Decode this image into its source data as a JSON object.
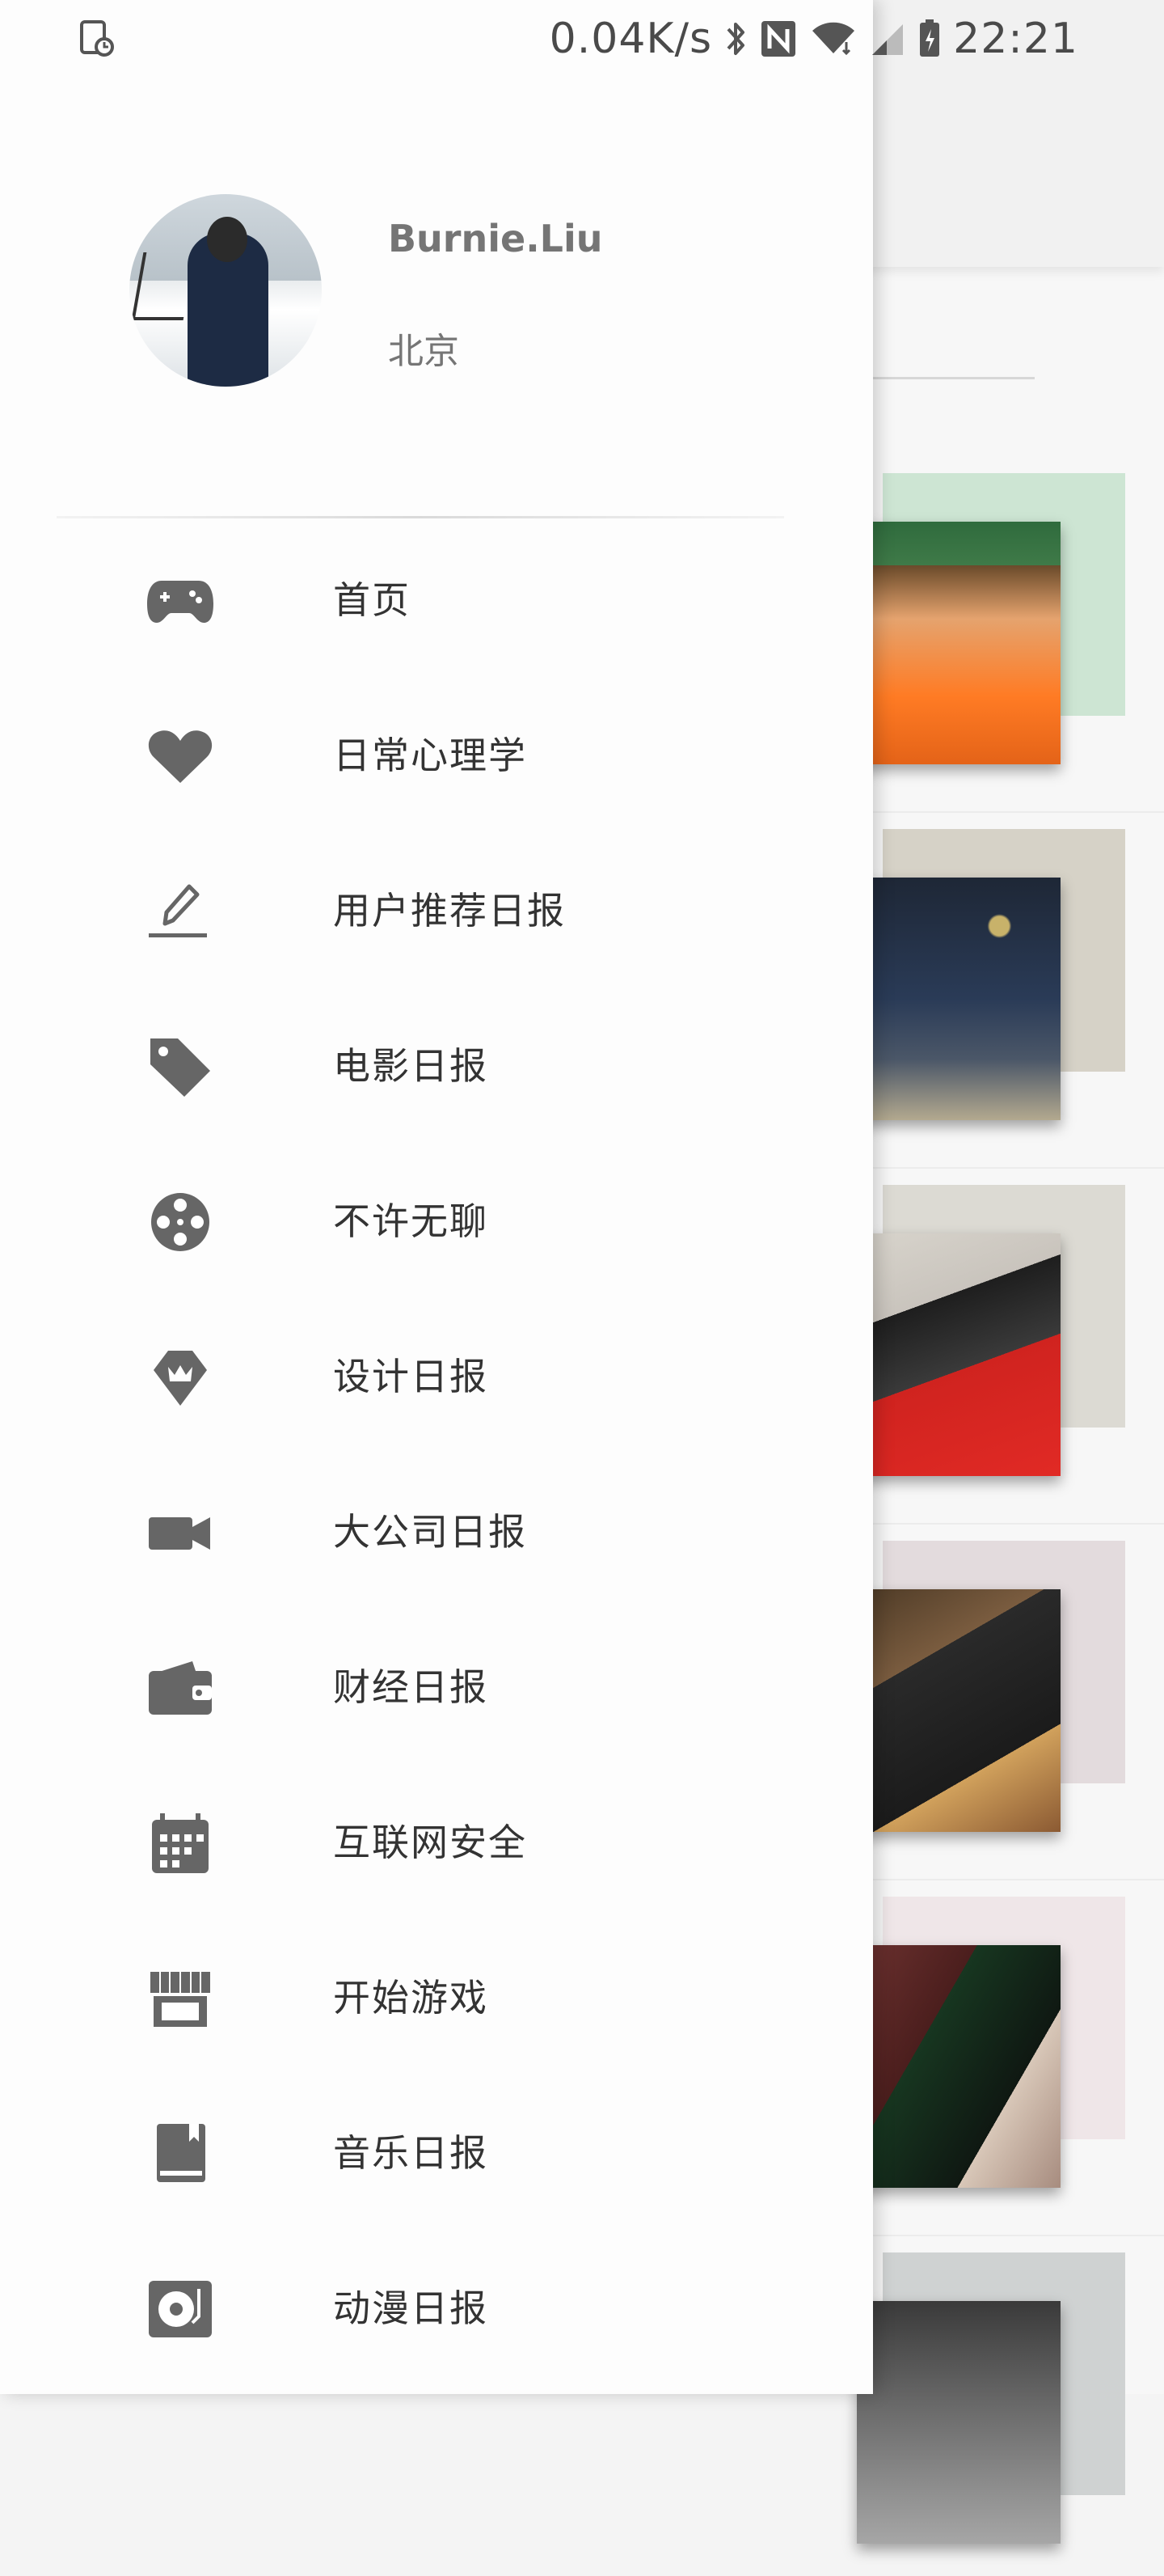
{
  "status_bar": {
    "speed": "0.04K/s",
    "time": "22:21",
    "icons": [
      "screen-recorder-icon",
      "bluetooth-icon",
      "nfc-icon",
      "wifi-icon",
      "signal-icon",
      "battery-icon"
    ]
  },
  "drawer": {
    "user": {
      "name": "Burnie.Liu",
      "city": "北京"
    },
    "menu": [
      {
        "label": "首页",
        "icon": "gamepad-icon"
      },
      {
        "label": "日常心理学",
        "icon": "heart-icon"
      },
      {
        "label": "用户推荐日报",
        "icon": "pen-icon"
      },
      {
        "label": "电影日报",
        "icon": "tag-icon"
      },
      {
        "label": "不许无聊",
        "icon": "film-reel-icon"
      },
      {
        "label": "设计日报",
        "icon": "design-badge-icon"
      },
      {
        "label": "大公司日报",
        "icon": "video-camera-icon"
      },
      {
        "label": "财经日报",
        "icon": "wallet-icon"
      },
      {
        "label": "互联网安全",
        "icon": "calendar-icon"
      },
      {
        "label": "开始游戏",
        "icon": "store-icon"
      },
      {
        "label": "音乐日报",
        "icon": "book-icon"
      },
      {
        "label": "动漫日报",
        "icon": "music-player-icon"
      }
    ]
  },
  "colors": {
    "icon": "#666666",
    "text": "#333333",
    "subtext": "#757575",
    "drawer_bg": "#fdfdfd",
    "swatches": [
      "#cde5d3",
      "#d6d2c7",
      "#dcdad3",
      "#e3dbdd",
      "#efe6e8",
      "#cfd2d2"
    ]
  }
}
